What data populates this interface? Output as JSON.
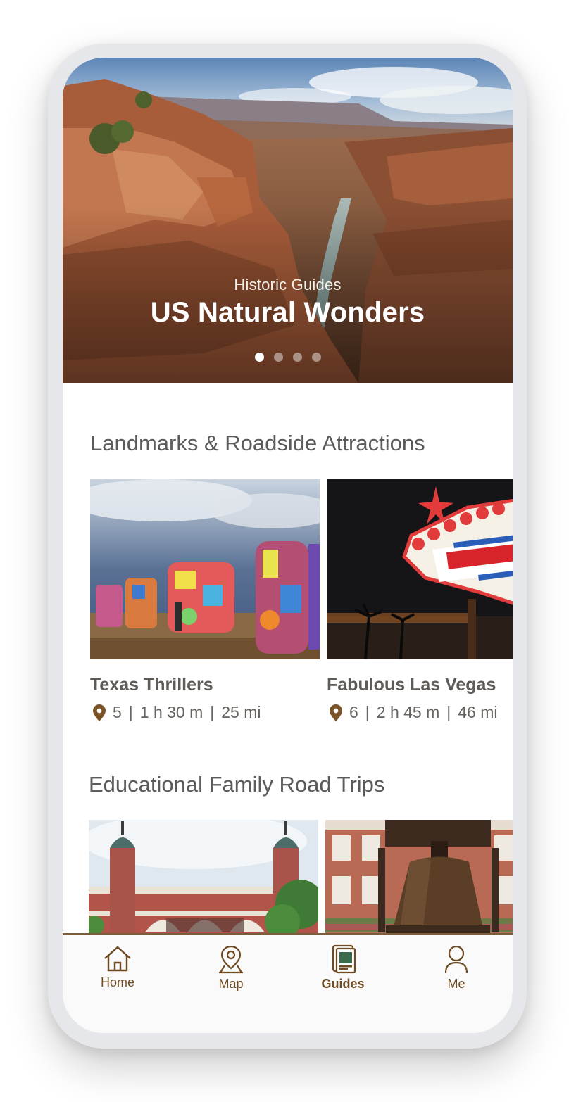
{
  "hero": {
    "subtitle": "Historic Guides",
    "title": "US Natural Wonders",
    "image_icon": "grand-canyon-photo",
    "carousel_pages": 4,
    "active_page": 1
  },
  "sections": [
    {
      "title": "Landmarks & Roadside Attractions",
      "cards": [
        {
          "title": "Texas Thrillers",
          "stops": "5",
          "duration": "1 h 30 m",
          "distance": "25 mi",
          "image_icon": "painted-cars-photo"
        },
        {
          "title": "Fabulous Las Vegas",
          "stops": "6",
          "duration": "2 h 45 m",
          "distance": "46 mi",
          "image_icon": "las-vegas-sign-photo"
        }
      ]
    },
    {
      "title": "Educational Family Road Trips",
      "cards": [
        {
          "image_icon": "ellis-island-photo"
        },
        {
          "image_icon": "liberty-bell-photo"
        }
      ]
    }
  ],
  "meta_separator": "|",
  "nav": {
    "items": [
      {
        "label": "Home",
        "icon": "home-icon"
      },
      {
        "label": "Map",
        "icon": "map-pin-icon"
      },
      {
        "label": "Guides",
        "icon": "guides-icon"
      },
      {
        "label": "Me",
        "icon": "profile-icon"
      }
    ],
    "active": "Guides"
  },
  "colors": {
    "accent": "#6e4b22",
    "section_title": "#5b5b5b",
    "card_text": "#5f5b57",
    "nav_border": "#7a5e3c"
  }
}
